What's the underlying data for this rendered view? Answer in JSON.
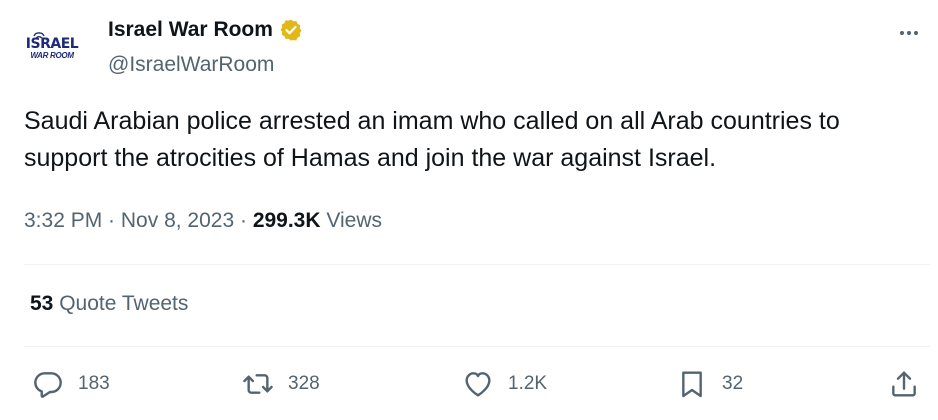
{
  "author": {
    "display_name": "Israel War Room",
    "handle": "@IsraelWarRoom",
    "avatar_logo_top": "ISRAEL",
    "avatar_logo_bottom": "WAR ROOM",
    "verified_color": "#e2b719"
  },
  "tweet": {
    "text": "Saudi Arabian police arrested an imam who called on all Arab countries to support the atrocities of Hamas and join the war against Israel.",
    "time": "3:32 PM",
    "date": "Nov 8, 2023",
    "separator": " · ",
    "views_count": "299.3K",
    "views_label": " Views"
  },
  "quotes": {
    "count": "53",
    "label": " Quote Tweets"
  },
  "actions": {
    "reply_count": "183",
    "retweet_count": "328",
    "like_count": "1.2K",
    "bookmark_count": "32"
  },
  "icons": {
    "more": "more-dots-icon",
    "reply": "reply-icon",
    "retweet": "retweet-icon",
    "like": "heart-icon",
    "bookmark": "bookmark-icon",
    "share": "share-icon",
    "verified": "verified-badge-icon"
  }
}
